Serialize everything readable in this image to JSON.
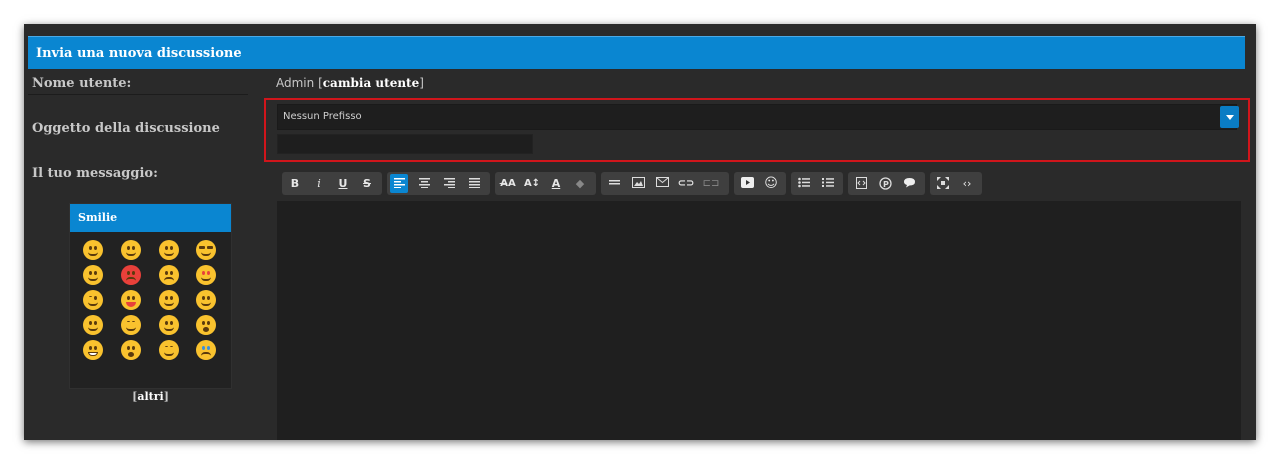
{
  "form": {
    "title": "Invia una nuova discussione",
    "username_label": "Nome utente:",
    "username_value": "Admin",
    "change_user_label": "cambia utente",
    "subject_label": "Oggetto della discussione",
    "prefix_selected": "Nessun Prefisso",
    "subject_value": "",
    "message_label": "Il tuo messaggio:"
  },
  "smilie": {
    "title": "Smilie",
    "more_label": "altri"
  },
  "colors": {
    "accent": "#0a86d1",
    "highlight_border": "#d0151b",
    "panel_bg": "#2a2a2a"
  },
  "toolbar_icons": [
    "bold-icon",
    "italic-icon",
    "underline-icon",
    "strikethrough-icon",
    "align-left-icon",
    "align-center-icon",
    "align-right-icon",
    "justify-icon",
    "font-family-icon",
    "font-size-icon",
    "font-color-icon",
    "remove-format-icon",
    "horizontal-rule-icon",
    "image-icon",
    "email-icon",
    "link-icon",
    "unlink-icon",
    "youtube-icon",
    "emoticon-icon",
    "bullet-list-icon",
    "numbered-list-icon",
    "code-icon",
    "php-icon",
    "quote-icon",
    "maximize-icon",
    "source-mode-icon"
  ]
}
